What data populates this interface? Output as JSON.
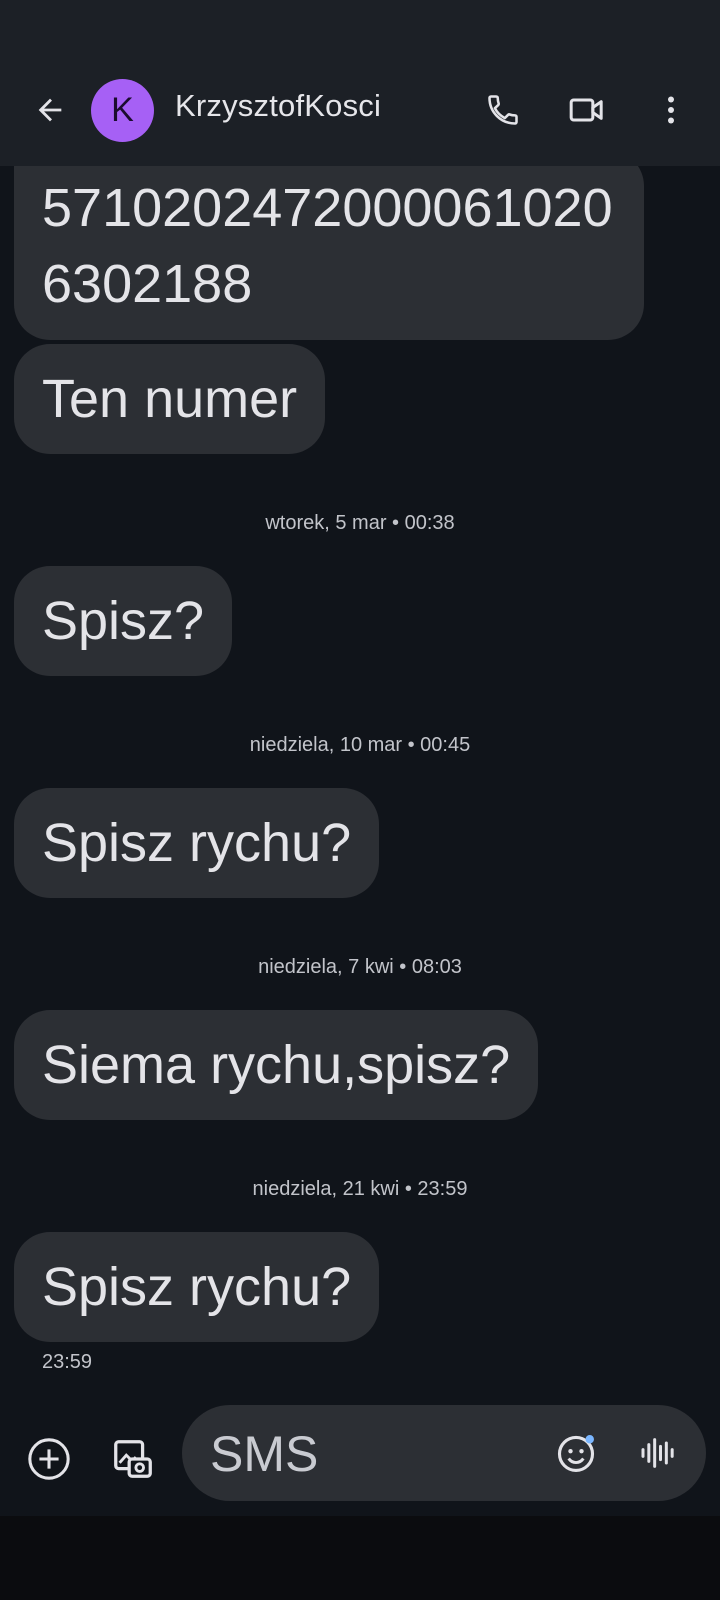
{
  "header": {
    "avatar_letter": "K",
    "contact_name": "KrzysztofKosci"
  },
  "messages": [
    {
      "text": "5710202472000061020 6302188"
    },
    {
      "text": "Ten numer"
    },
    {
      "separator": "wtorek, 5 mar • 00:38",
      "text": "Spisz?"
    },
    {
      "separator": "niedziela, 10 mar • 00:45",
      "text": "Spisz rychu?"
    },
    {
      "separator": "niedziela, 7 kwi • 08:03",
      "text": "Siema rychu,spisz?"
    },
    {
      "separator": "niedziela, 21 kwi • 23:59",
      "text": "Spisz rychu?"
    }
  ],
  "last_message_time": "23:59",
  "compose": {
    "placeholder": "SMS"
  },
  "colors": {
    "background": "#10141a",
    "header": "#1c2026",
    "bubble": "#2c2f34",
    "avatar": "#a660f5",
    "emoji_dot": "#7ab6ff"
  },
  "icons": [
    "back-arrow-icon",
    "phone-icon",
    "video-camera-icon",
    "more-vert-icon",
    "add-circle-icon",
    "gallery-icon",
    "emoji-icon",
    "voice-waveform-icon"
  ]
}
